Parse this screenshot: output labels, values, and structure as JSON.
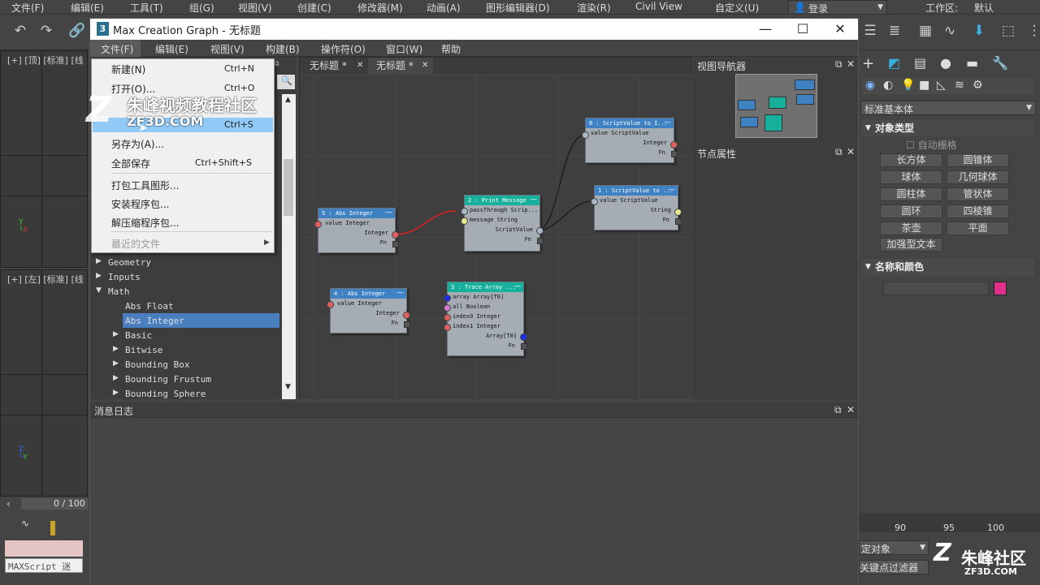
{
  "top_menu": [
    "文件(F)",
    "编辑(E)",
    "工具(T)",
    "组(G)",
    "视图(V)",
    "创建(C)",
    "修改器(M)",
    "动画(A)",
    "图形编辑器(D)",
    "渲染(R)",
    "Civil View",
    "自定义(U)"
  ],
  "login": "登录",
  "workspace": {
    "label": "工作区:",
    "value": "默认"
  },
  "viewports": {
    "top": "[+] [顶] [标准] [线",
    "left": "[+] [左] [标准] [线"
  },
  "timeline": {
    "frame": "0 / 100",
    "maxscript": "MAXScript 迷"
  },
  "mcg": {
    "title": "Max Creation Graph - 无标题",
    "menu": [
      "文件(F)",
      "编辑(E)",
      "视图(V)",
      "构建(B)",
      "操作符(O)",
      "窗口(W)",
      "帮助"
    ],
    "tabs": [
      "无标题 *",
      "无标题 *"
    ],
    "file_menu": {
      "items": [
        {
          "label": "新建(N)",
          "shortcut": "Ctrl+N"
        },
        {
          "label": "打开(O)...",
          "shortcut": "Ctrl+O"
        },
        {
          "label": "另存为(A)...",
          "shortcut": ""
        },
        {
          "label": "全部保存",
          "shortcut": "Ctrl+Shift+S"
        },
        {
          "label": "打包工具图形...",
          "shortcut": ""
        },
        {
          "label": "安装程序包...",
          "shortcut": ""
        },
        {
          "label": "解压缩程序包...",
          "shortcut": ""
        },
        {
          "label": "最近的文件",
          "shortcut": ""
        }
      ],
      "highlight_shortcut": "Ctrl+S"
    },
    "tree": [
      {
        "label": "Geometry",
        "level": 0,
        "arrow": "right"
      },
      {
        "label": "Inputs",
        "level": 0,
        "arrow": "right"
      },
      {
        "label": "Math",
        "level": 0,
        "arrow": "down"
      },
      {
        "label": "Abs Float",
        "level": 1,
        "arrow": ""
      },
      {
        "label": "Abs Integer",
        "level": 1,
        "arrow": "",
        "selected": true
      },
      {
        "label": "Basic",
        "level": 1,
        "arrow": "right"
      },
      {
        "label": "Bitwise",
        "level": 1,
        "arrow": "right"
      },
      {
        "label": "Bounding Box",
        "level": 1,
        "arrow": "right"
      },
      {
        "label": "Bounding Frustum",
        "level": 1,
        "arrow": "right"
      },
      {
        "label": "Bounding Sphere",
        "level": 1,
        "arrow": "right"
      }
    ],
    "navigator_title": "视图导航器",
    "props_title": "节点属性",
    "log_title": "消息日志",
    "nodes": [
      {
        "title": "5 : Abs Integer",
        "color": "#3f82c4",
        "rows": [
          "value Integer",
          "Integer",
          "Fn"
        ]
      },
      {
        "title": "2 : Print Message",
        "color": "#17b09c",
        "rows": [
          "passThrough Scrip...",
          "message String",
          "ScriptValue",
          "Fn"
        ]
      },
      {
        "title": "0 : ScriptValue to I...",
        "color": "#3f82c4",
        "rows": [
          "value ScriptValue",
          "Integer",
          "Fn"
        ]
      },
      {
        "title": "1 : ScriptValue to ...",
        "color": "#3f82c4",
        "rows": [
          "value ScriptValue",
          "String",
          "Fn"
        ]
      },
      {
        "title": "4 : Abs Integer",
        "color": "#3f82c4",
        "rows": [
          "value Integer",
          "Integer",
          "Fn"
        ]
      },
      {
        "title": "3 : Trace Array ...",
        "color": "#17b09c",
        "rows": [
          "array Array[T0]",
          "all Boolean",
          "index0 Integer",
          "index1 Integer",
          "Array[T0]",
          "Fn"
        ]
      }
    ]
  },
  "right_panel": {
    "dropdown": "标准基本体",
    "object_type": "对象类型",
    "auto_grid": "自动栅格",
    "buttons": [
      "长方体",
      "圆锥体",
      "球体",
      "几何球体",
      "圆柱体",
      "管状体",
      "圆环",
      "四棱锥",
      "茶壶",
      "平面",
      "加强型文本"
    ],
    "name_color": "名称和颜色",
    "swatch_color": "#e0308a",
    "ruler": [
      "90",
      "95",
      "100"
    ],
    "selset": "定对象",
    "keyfilter": "关键点过滤器"
  },
  "watermark": {
    "text": "朱峰视频教程社区",
    "url": "ZF3D.COM",
    "corner": "朱峰社区",
    "corner_url": "ZF3D.COM"
  }
}
